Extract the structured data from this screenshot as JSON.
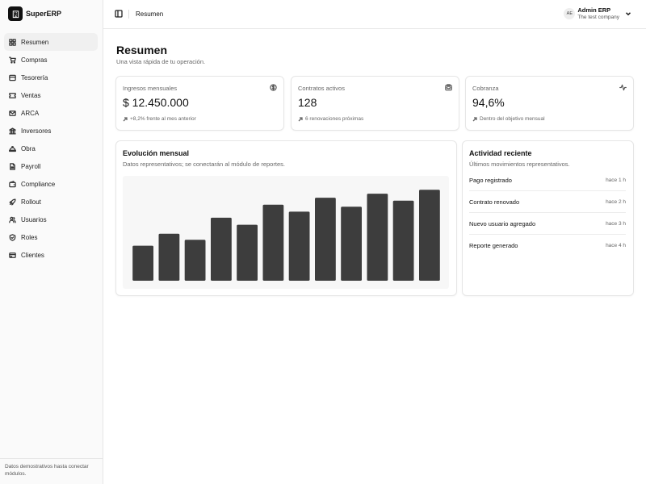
{
  "app": {
    "name": "SuperERP"
  },
  "sidebar": {
    "items": [
      {
        "label": "Resumen",
        "icon": "dashboard-icon",
        "active": true
      },
      {
        "label": "Compras",
        "icon": "cart-icon"
      },
      {
        "label": "Tesorería",
        "icon": "vault-icon"
      },
      {
        "label": "Ventas",
        "icon": "ticket-icon"
      },
      {
        "label": "ARCA",
        "icon": "mail-icon"
      },
      {
        "label": "Inversores",
        "icon": "bank-icon"
      },
      {
        "label": "Obra",
        "icon": "helmet-icon"
      },
      {
        "label": "Payroll",
        "icon": "file-icon"
      },
      {
        "label": "Compliance",
        "icon": "wallet-icon"
      },
      {
        "label": "Rollout",
        "icon": "rocket-icon"
      },
      {
        "label": "Usuarios",
        "icon": "users-icon"
      },
      {
        "label": "Roles",
        "icon": "shield-icon"
      },
      {
        "label": "Clientes",
        "icon": "card-icon"
      }
    ],
    "footer": "Datos demostrativos hasta conectar módulos."
  },
  "header": {
    "breadcrumb": "Resumen",
    "user": {
      "initials": "AE",
      "name": "Admin ERP",
      "company": "The test company"
    }
  },
  "page": {
    "title": "Resumen",
    "subtitle": "Una vista rápida de tu operación."
  },
  "kpis": [
    {
      "label": "Ingresos mensuales",
      "value": "$ 12.450.000",
      "footnote": "+8,2% frente al mes anterior",
      "icon": "dollar-icon"
    },
    {
      "label": "Contratos activos",
      "value": "128",
      "footnote": "6 renovaciones próximas",
      "icon": "inbox-icon"
    },
    {
      "label": "Cobranza",
      "value": "94,6%",
      "footnote": "Dentro del objetivo mensual",
      "icon": "activity-icon"
    }
  ],
  "chart_card": {
    "title": "Evolución mensual",
    "subtitle": "Datos representativos; se conectarán al módulo de reportes."
  },
  "chart_data": {
    "type": "bar",
    "categories": [],
    "values": [
      35,
      47,
      41,
      63,
      56,
      76,
      69,
      83,
      74,
      87,
      80,
      91
    ],
    "ylim": [
      0,
      100
    ],
    "title": "",
    "xlabel": "",
    "ylabel": "",
    "bar_color": "#3d3d3d",
    "grid": false
  },
  "activity": {
    "title": "Actividad reciente",
    "subtitle": "Últimos movimientos representativos.",
    "items": [
      {
        "name": "Pago registrado",
        "time": "hace 1 h"
      },
      {
        "name": "Contrato renovado",
        "time": "hace 2 h"
      },
      {
        "name": "Nuevo usuario agregado",
        "time": "hace 3 h"
      },
      {
        "name": "Reporte generado",
        "time": "hace 4 h"
      }
    ]
  }
}
